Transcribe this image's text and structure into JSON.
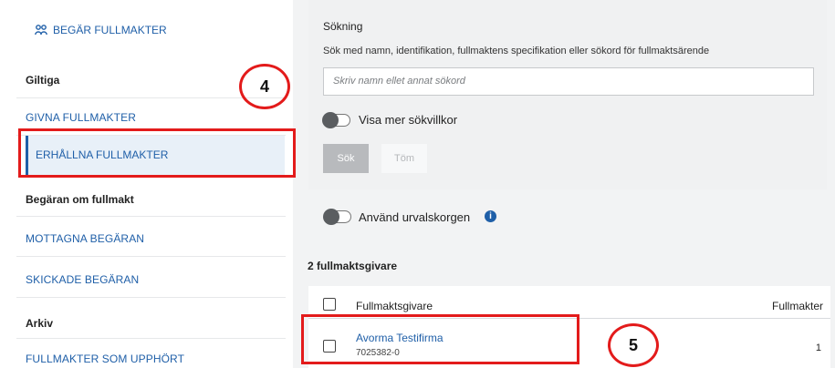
{
  "sidebar": {
    "request_link": "BEGÄR FULLMAKTER",
    "valid_heading": "Giltiga",
    "given": "GIVNA FULLMAKTER",
    "received": "ERHÅLLNA FULLMAKTER",
    "requests_heading": "Begäran om fullmakt",
    "received_requests": "MOTTAGNA BEGÄRAN",
    "sent_requests": "SKICKADE BEGÄRAN",
    "archive_heading": "Arkiv",
    "expired": "FULLMAKTER SOM UPPHÖRT"
  },
  "annotations": {
    "step4": "4",
    "step5": "5"
  },
  "search": {
    "title": "Sökning",
    "description": "Sök med namn, identifikation, fullmaktens specifikation eller sökord för fullmaktsärende",
    "placeholder": "Skriv namn ellet annat sökord",
    "more_criteria": "Visa mer sökvillkor",
    "search_button": "Sök",
    "clear_button": "Töm"
  },
  "basket": {
    "label": "Använd urvalskorgen",
    "info_icon": "i"
  },
  "results": {
    "count_label": "2 fullmaktsgivare",
    "columns": [
      "Fullmaktsgivare",
      "Fullmakter"
    ],
    "rows": [
      {
        "name": "Avorma Testifirma",
        "id": "7025382-0",
        "count": "1"
      }
    ]
  },
  "icons": {
    "request": "people-icon"
  },
  "colors": {
    "link": "#1f5fa8",
    "annotation": "#e31b1b",
    "active_bg": "#e8f0f8"
  }
}
